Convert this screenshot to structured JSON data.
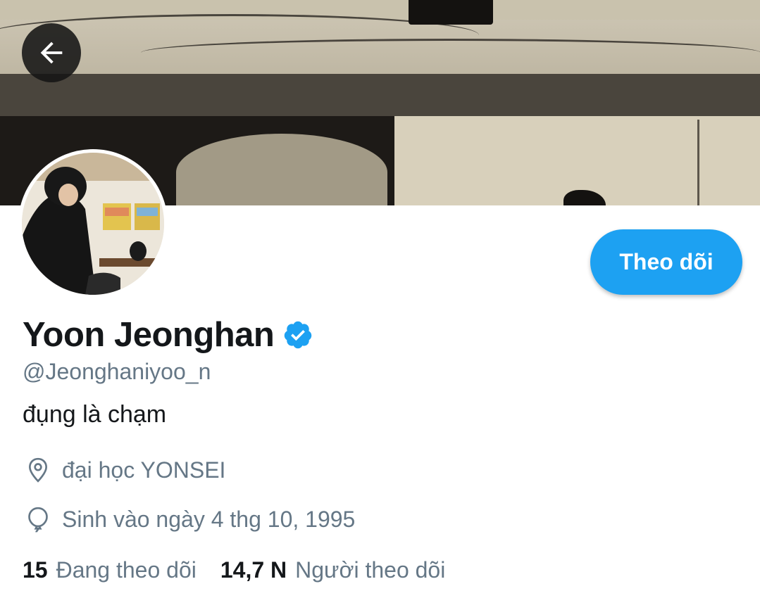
{
  "header": {
    "back_icon": "arrow-left-icon"
  },
  "profile": {
    "display_name": "Yoon Jeonghan",
    "verified_icon": "verified-badge-icon",
    "handle": "@Jeonghaniyoo_n",
    "bio": "đụng là chạm",
    "location_icon": "location-pin-icon",
    "location": "đại học YONSEI",
    "birthday_icon": "balloon-icon",
    "birthday": "Sinh vào ngày 4 thg 10, 1995",
    "follow_button_label": "Theo dõi"
  },
  "stats": {
    "following_count": "15",
    "following_label": "Đang theo dõi",
    "followers_count": "14,7 N",
    "followers_label": "Người theo dõi"
  },
  "colors": {
    "accent": "#1da1f2",
    "secondary_text": "#657786",
    "primary_text": "#14171a"
  }
}
